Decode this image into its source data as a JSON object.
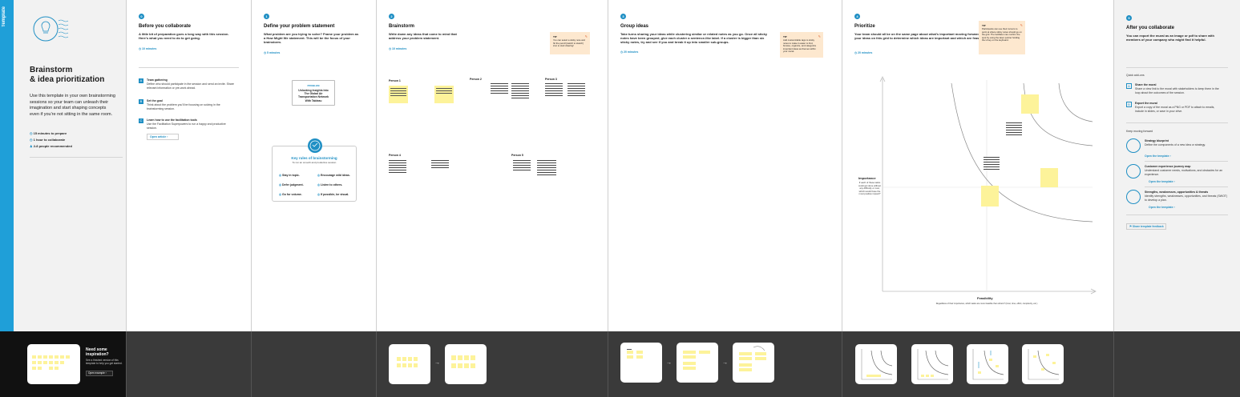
{
  "strip_label": "Template",
  "intro": {
    "title_line1": "Brainstorm",
    "title_line2": "& idea prioritization",
    "description": "Use this template in your own brainstorming sessions so your team can unleash their imagination and start shaping concepts even if you're not sitting in the same room.",
    "meta": [
      "15 minutes to prepare",
      "1 hour to collaborate",
      "2-8 people recommended"
    ],
    "promo_title": "Need some inspiration?",
    "promo_text": "See a finished version of this template to help you get started.",
    "promo_button": "Open example"
  },
  "before": {
    "num": "0",
    "title": "Before you collaborate",
    "desc": "A little bit of preparation goes a long way with this session. Here's what you need to do to get going.",
    "time": "10 minutes",
    "steps": [
      {
        "letter": "A",
        "title": "Team gathering",
        "text": "Define who should participate in the session and send an invite. Share relevant information or pre-work ahead."
      },
      {
        "letter": "B",
        "title": "Set the goal",
        "text": "Think about the problem you'll be focusing on solving in the brainstorming session."
      },
      {
        "letter": "C",
        "title": "Learn how to use the facilitation tools",
        "text": "Use the Facilitation Superpowers to run a happy and productive session."
      }
    ],
    "open_article": "Open article"
  },
  "define": {
    "num": "1",
    "title": "Define your problem statement",
    "desc": "What problem are you trying to solve? Frame your problem as a How Might We statement. This will be the focus of your brainstorm.",
    "time": "5 minutes",
    "card_label": "PROBLEM",
    "card_text": "Unlocking Insights Into The Global Air Transportation Network With Tableau",
    "rules_title": "Key rules of brainstorming",
    "rules_sub": "To run an smooth and productive session",
    "rules": [
      "Stay in topic.",
      "Encourage wild ideas.",
      "Defer judgment.",
      "Listen to others.",
      "Go for volume.",
      "If possible, be visual."
    ]
  },
  "brainstorm": {
    "num": "2",
    "title": "Brainstorm",
    "desc": "Write down any ideas that come to mind that address your problem statement.",
    "time": "10 minutes",
    "tip_label": "TIP",
    "tip_text": "You can select a sticky note and hit the pencil [switch to sketch] icon to start drawing!",
    "persons": [
      "Person 1",
      "Person 2",
      "Person 3",
      "Person 4",
      "Person 5"
    ]
  },
  "group": {
    "num": "3",
    "title": "Group ideas",
    "desc": "Take turns sharing your ideas while clustering similar or related notes as you go. Once all sticky notes have been grouped, give each cluster a sentence-like label. If a cluster is bigger than six sticky notes, try and see if you and break it up into smaller sub-groups.",
    "time": "20 minutes",
    "tip_label": "TIP",
    "tip_text": "Add customizable tags to sticky notes to make it easier to find, browse, organize, and categorize important ideas as themes within your mural."
  },
  "prioritize": {
    "num": "4",
    "title": "Prioritize",
    "desc": "Your team should all be on the same page about what's important moving forward. Place your ideas on this grid to determine which ideas are important and which are feasible.",
    "time": "20 minutes",
    "tip_label": "TIP",
    "tip_text": "Participants can use their cursors to point at where sticky notes should go on the grid. The facilitator can confirm the spot by using the laser pointer holding the H key on the keyboard.",
    "y_label": "Importance",
    "y_desc": "If each of these tasks could get done without any difficulty or cost, which would have the most positive impact?",
    "x_label": "Feasibility",
    "x_desc": "Regardless of their importance, which tasks are more feasible than others? (Cost, time, effort, complexity, etc.)"
  },
  "after": {
    "num": "5",
    "title": "After you collaborate",
    "desc": "You can export the mural as an image or pdf to share with members of your company who might find it helpful.",
    "quick_addons": "Quick add-ons",
    "addons": [
      {
        "letter": "A",
        "title": "Share the mural",
        "text": "Share a view link to the mural with stakeholders to keep them in the loop about the outcomes of the session."
      },
      {
        "letter": "B",
        "title": "Export the mural",
        "text": "Export a copy of the mural as a PNG or PDF to attach to emails, include in slides, or save in your drive."
      }
    ],
    "keep_moving": "Keep moving forward",
    "templates": [
      {
        "title": "Strategy blueprint",
        "text": "Define the components of a new idea or strategy.",
        "link": "Open the template"
      },
      {
        "title": "Customer experience journey map",
        "text": "Understand customer needs, motivations, and obstacles for an experience.",
        "link": "Open the template"
      },
      {
        "title": "Strengths, weaknesses, opportunities & threats",
        "text": "Identify strengths, weaknesses, opportunities, and threats (SWOT) to develop a plan.",
        "link": "Open the template"
      }
    ],
    "feedback": "Share template feedback"
  }
}
